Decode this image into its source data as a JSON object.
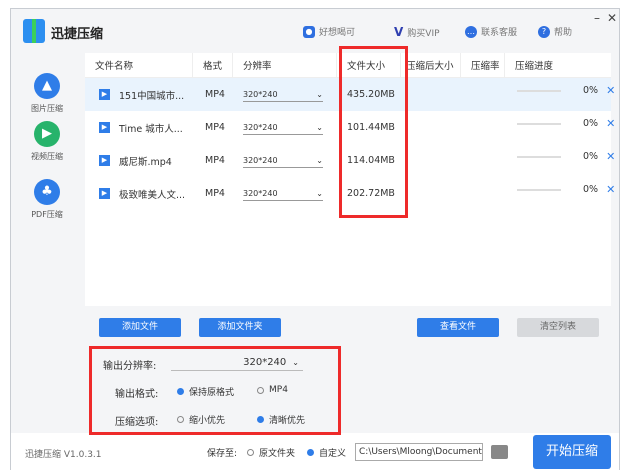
{
  "app": {
    "title": "迅捷压缩",
    "version": "迅捷压缩 V1.0.3.1"
  },
  "header": {
    "user": "好想喝可",
    "vip": "购买VIP",
    "service": "联系客服",
    "help": "帮助",
    "minimize": "–",
    "close": "✕"
  },
  "sidebar": {
    "items": [
      {
        "label": "图片压缩"
      },
      {
        "label": "视频压缩"
      },
      {
        "label": "PDF压缩"
      }
    ]
  },
  "table": {
    "columns": [
      "文件名称",
      "格式",
      "分辨率",
      "文件大小",
      "压缩后大小",
      "压缩率",
      "压缩进度"
    ],
    "rows": [
      {
        "name": "151中国城市...",
        "format": "MP4",
        "resolution": "320*240",
        "size": "435.20MB",
        "progress": "0%"
      },
      {
        "name": "Time 城市人...",
        "format": "MP4",
        "resolution": "320*240",
        "size": "101.44MB",
        "progress": "0%"
      },
      {
        "name": "威尼斯.mp4",
        "format": "MP4",
        "resolution": "320*240",
        "size": "114.04MB",
        "progress": "0%"
      },
      {
        "name": "极致唯美人文...",
        "format": "MP4",
        "resolution": "320*240",
        "size": "202.72MB",
        "progress": "0%"
      }
    ]
  },
  "buttons": {
    "add_file": "添加文件",
    "add_folder": "添加文件夹",
    "view_file": "查看文件",
    "clear_list": "清空列表",
    "start": "开始压缩"
  },
  "options": {
    "resolution_label": "输出分辨率:",
    "resolution_value": "320*240",
    "format_label": "输出格式:",
    "format_keep": "保持原格式",
    "format_mp4": "MP4",
    "compress_label": "压缩选项:",
    "compress_small": "缩小优先",
    "compress_clear": "清晰优先"
  },
  "save": {
    "label": "保存至:",
    "original": "原文件夹",
    "custom": "自定义",
    "path": "C:\\Users\\Mloong\\Documents"
  },
  "colors": {
    "accent": "#2f7de8",
    "highlight": "#ee2a2a"
  }
}
